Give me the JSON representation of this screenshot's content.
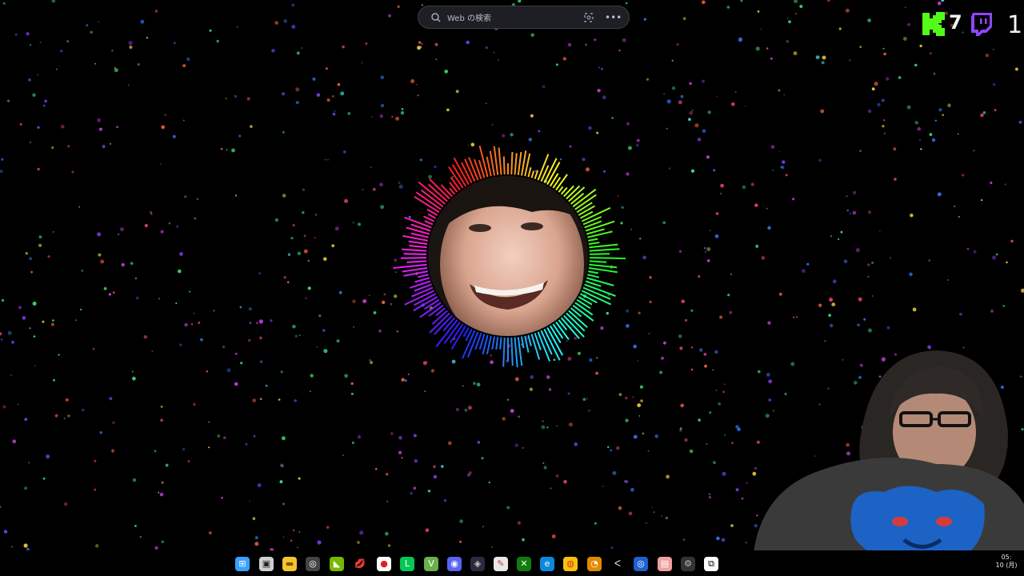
{
  "search": {
    "placeholder": "Web の検索"
  },
  "kick": {
    "count": "7"
  },
  "twitch": {
    "count": "1"
  },
  "clock": {
    "time": "05:",
    "date": "10 (月)"
  },
  "taskbar_items": [
    "start",
    "task-view",
    "file-explorer",
    "chrome-app",
    "nvidia",
    "lips-app",
    "record",
    "line",
    "vim",
    "discord",
    "obs",
    "notepad",
    "xbox",
    "edge",
    "chrome",
    "obs-studio",
    "dev-tool",
    "blue-app",
    "image-viewer",
    "settings",
    "capcut"
  ],
  "colors": {
    "kick": "#53fc18",
    "twitch": "#9146ff"
  }
}
